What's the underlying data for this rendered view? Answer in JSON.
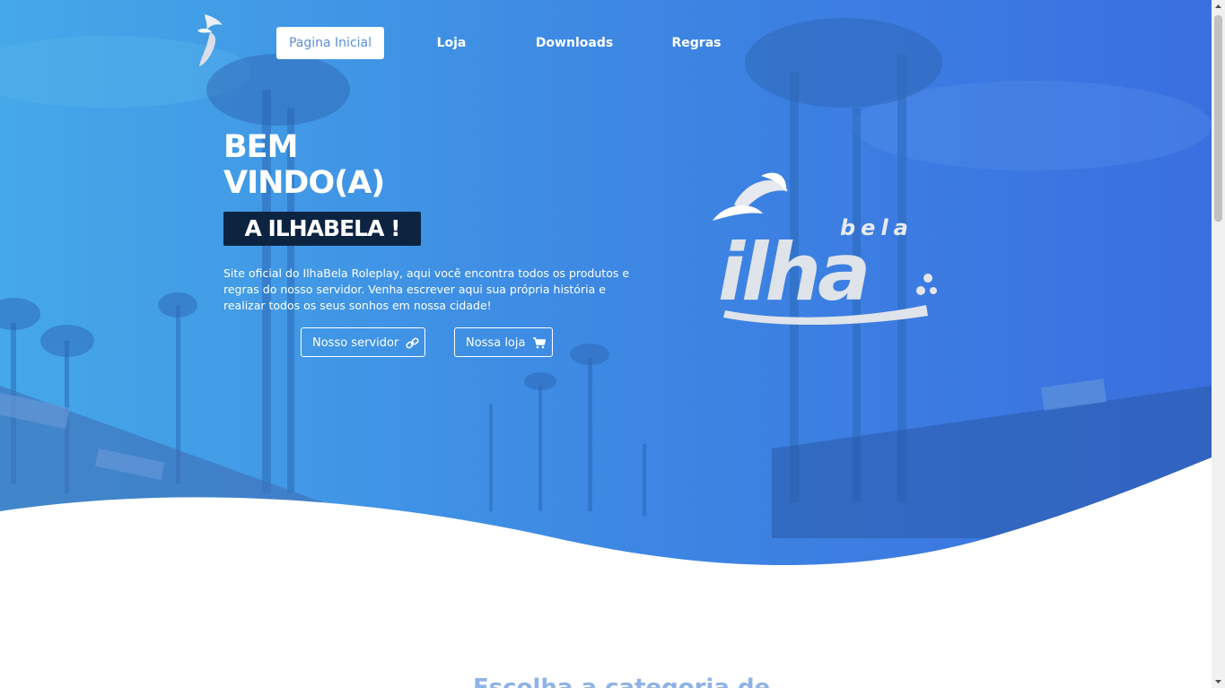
{
  "nav": {
    "logo_icon": "island-leaf-logo-icon",
    "items": [
      {
        "label": "Pagina Inicial",
        "active": true
      },
      {
        "label": "Loja",
        "active": false
      },
      {
        "label": "Downloads",
        "active": false
      },
      {
        "label": "Regras",
        "active": false
      }
    ]
  },
  "hero": {
    "title_line1": "BEM",
    "title_line2": "VINDO(A)",
    "title_badge": "A ILHABELA !",
    "description": "Site oficial do IlhaBela Roleplay, aqui você encontra todos os produtos e regras do nosso servidor. Venha escrever aqui sua própria história e realizar todos os seus sonhos em nossa cidade!",
    "buttons": [
      {
        "label": "Nosso servidor",
        "icon": "link-icon"
      },
      {
        "label": "Nossa loja",
        "icon": "cart-icon"
      }
    ],
    "logo_text_main": "ilha",
    "logo_text_small": "bela"
  },
  "section": {
    "title_partial": "Escolha a categoria de"
  },
  "colors": {
    "hero_start": "#3fa3e6",
    "hero_end": "#3a70e2",
    "badge_bg": "#0d2441",
    "active_nav_text": "#5a8fd8",
    "section_title": "#8fb3e6"
  }
}
